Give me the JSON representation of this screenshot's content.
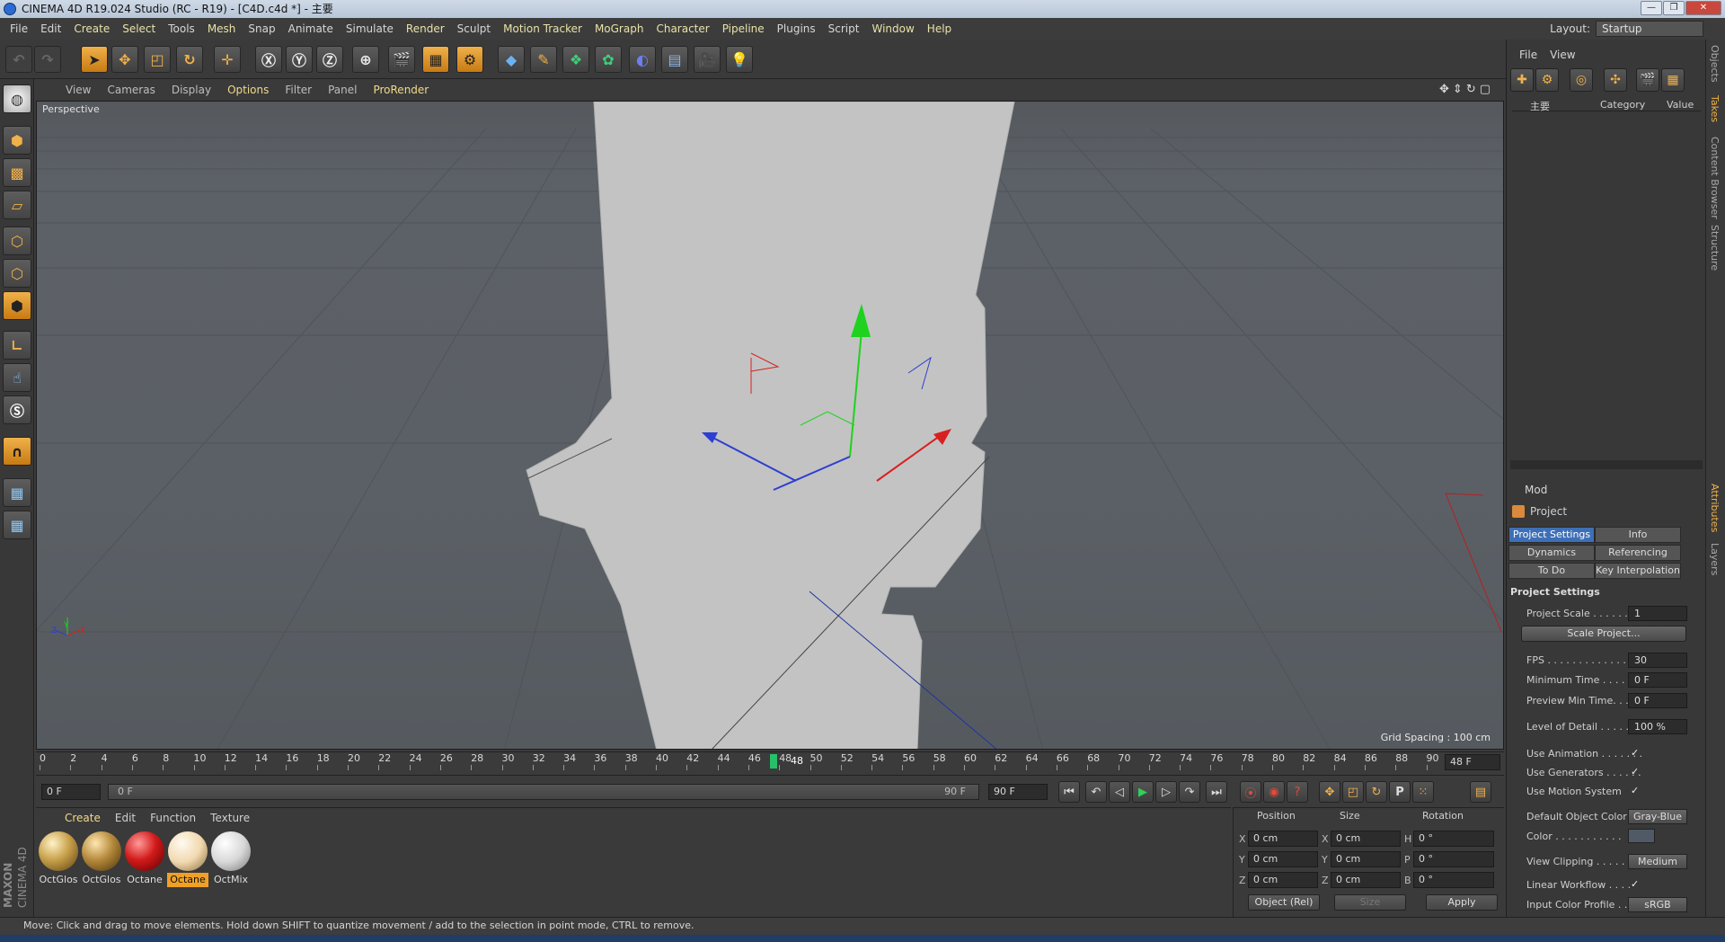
{
  "window": {
    "title": "CINEMA 4D R19.024 Studio (RC - R19) - [C4D.c4d *] - 主要",
    "controls": [
      "—",
      "❐",
      "✕"
    ]
  },
  "menubar": [
    "File",
    "Edit",
    "Create",
    "Select",
    "Tools",
    "Mesh",
    "Snap",
    "Animate",
    "Simulate",
    "Render",
    "Sculpt",
    "Motion Tracker",
    "MoGraph",
    "Character",
    "Pipeline",
    "Plugins",
    "Script",
    "Window",
    "Help"
  ],
  "layout": {
    "label": "Layout:",
    "value": "Startup"
  },
  "viewport": {
    "menu": [
      "View",
      "Cameras",
      "Display",
      "Options",
      "Filter",
      "Panel",
      "ProRender"
    ],
    "label": "Perspective",
    "grid_spacing": "Grid Spacing : 100 cm",
    "axis_labels": {
      "x": "X",
      "y": "Y",
      "z": "Z"
    }
  },
  "timeline": {
    "ticks": [
      "0",
      "2",
      "4",
      "6",
      "8",
      "10",
      "12",
      "14",
      "16",
      "18",
      "20",
      "22",
      "24",
      "26",
      "28",
      "30",
      "32",
      "34",
      "36",
      "38",
      "40",
      "42",
      "44",
      "46",
      "48",
      "50",
      "52",
      "54",
      "56",
      "58",
      "60",
      "62",
      "64",
      "66",
      "68",
      "70",
      "72",
      "74",
      "76",
      "78",
      "80",
      "82",
      "84",
      "86",
      "88",
      "90"
    ],
    "current_frame": "48",
    "current_field": "48 F"
  },
  "transport": {
    "start": "0 F",
    "slider_start": "0 F",
    "slider_end": "90 F",
    "end": "90 F",
    "record_key": "P"
  },
  "materials": {
    "menu": [
      "Create",
      "Edit",
      "Function",
      "Texture"
    ],
    "items": [
      {
        "name": "OctGlos",
        "color": "#c8a04a",
        "selected": false
      },
      {
        "name": "OctGlos",
        "color": "#b58a3c",
        "selected": false
      },
      {
        "name": "Octane",
        "color": "#d21a1a",
        "selected": false
      },
      {
        "name": "Octane",
        "color": "#f1d9b0",
        "selected": true
      },
      {
        "name": "OctMix",
        "color": "#d8d8d8",
        "selected": false
      }
    ]
  },
  "coordinates": {
    "headers": [
      "Position",
      "Size",
      "Rotation"
    ],
    "rows": [
      {
        "axis": "X",
        "pos": "0 cm",
        "saxis": "X",
        "size": "0 cm",
        "raxis": "H",
        "rot": "0 °"
      },
      {
        "axis": "Y",
        "pos": "0 cm",
        "saxis": "Y",
        "size": "0 cm",
        "raxis": "P",
        "rot": "0 °"
      },
      {
        "axis": "Z",
        "pos": "0 cm",
        "saxis": "Z",
        "size": "0 cm",
        "raxis": "B",
        "rot": "0 °"
      }
    ],
    "mode": "Object (Rel)",
    "size_mode": "Size",
    "apply": "Apply"
  },
  "status": "Move: Click and drag to move elements. Hold down SHIFT to quantize movement / add to the selection in point mode, CTRL to remove.",
  "brand": {
    "maxon": "MAXON",
    "product": "CINEMA 4D"
  },
  "objects_panel": {
    "menu": [
      "File",
      "View"
    ],
    "columns": [
      "主要",
      "Category",
      "Value"
    ]
  },
  "attributes": {
    "mode": "Mod",
    "object": "Project",
    "tabs": [
      "Project Settings",
      "Info",
      "Dynamics",
      "Referencing",
      "To Do",
      "Key Interpolation"
    ],
    "section": "Project Settings",
    "props": [
      {
        "label": "Project Scale . . . . . . .",
        "value": "1"
      },
      {
        "label": "FPS . . . . . . . . . . . . . . .",
        "value": "30"
      },
      {
        "label": "Minimum Time . . . . .",
        "value": "0 F"
      },
      {
        "label": "Preview Min Time. . .",
        "value": "0 F"
      },
      {
        "label": "Level of Detail . . . . .",
        "value": "100 %"
      },
      {
        "label": "Use Animation . . . . . . .",
        "value": "✓"
      },
      {
        "label": "Use Generators . . . . . .",
        "value": "✓"
      },
      {
        "label": "Use Motion System",
        "value": "✓"
      },
      {
        "label": "Default Object Color",
        "value": "Gray-Blue"
      },
      {
        "label": "Color . . . . . . . . . . .",
        "value": ""
      },
      {
        "label": "View Clipping . . . . . . . .",
        "value": "Medium"
      },
      {
        "label": "Linear Workflow . . . .",
        "value": "✓"
      },
      {
        "label": "Input Color Profile . . .",
        "value": "sRGB"
      }
    ],
    "scale_button": "Scale Project..."
  },
  "side_tabs": [
    "Objects",
    "Takes",
    "Content Browser",
    "Structure",
    "Attributes",
    "Layers"
  ]
}
